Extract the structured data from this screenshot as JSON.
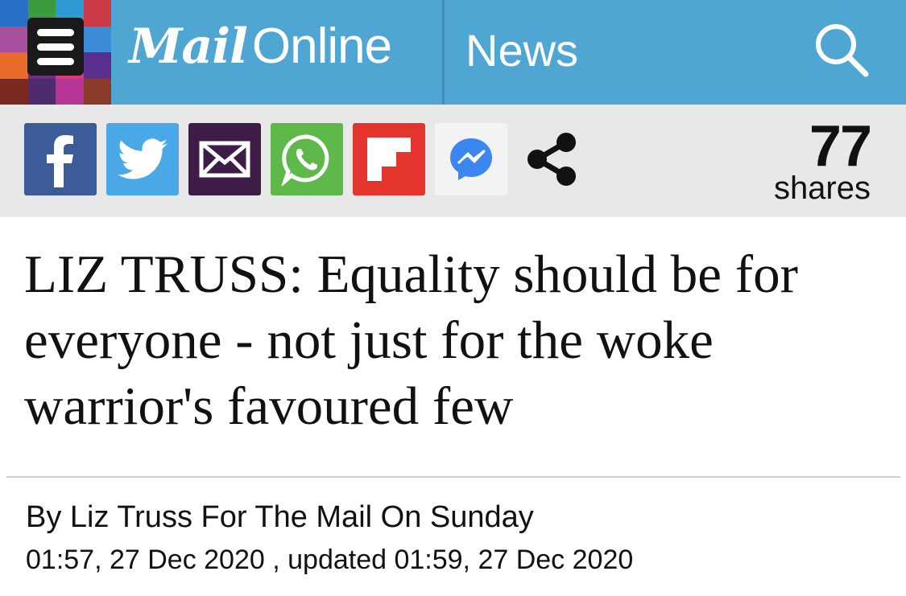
{
  "header": {
    "brand_mail": "Mail",
    "brand_online": "Online",
    "section": "News"
  },
  "colors": {
    "topbar": "#4fa6d3",
    "facebook": "#3b5b99",
    "twitter": "#4aa8e6",
    "email": "#3d1d46",
    "whatsapp": "#5fb94a",
    "flipboard": "#e3352e",
    "messenger": "#f3f3f3"
  },
  "mosaic_colors": [
    "#2a6fc7",
    "#3a9c3c",
    "#2f9ad5",
    "#c93a44",
    "#a84f9d",
    "#3a3a3a",
    "#5ec6c1",
    "#3b8bd9",
    "#e86b2b",
    "#6b2f7e",
    "#d9387a",
    "#5a2e8c",
    "#7a2a1f",
    "#4e2b6f",
    "#b43593",
    "#8a3b2a"
  ],
  "share": {
    "icons": [
      "facebook-icon",
      "twitter-icon",
      "email-icon",
      "whatsapp-icon",
      "flipboard-icon",
      "messenger-icon",
      "share-icon"
    ],
    "count": "77",
    "count_label": "shares"
  },
  "article": {
    "headline": "LIZ TRUSS: Equality should be for everyone - not just for the woke warrior's favoured few",
    "byline": "By Liz Truss For The Mail On Sunday",
    "dateline": "01:57, 27 Dec 2020 , updated 01:59, 27 Dec 2020"
  }
}
